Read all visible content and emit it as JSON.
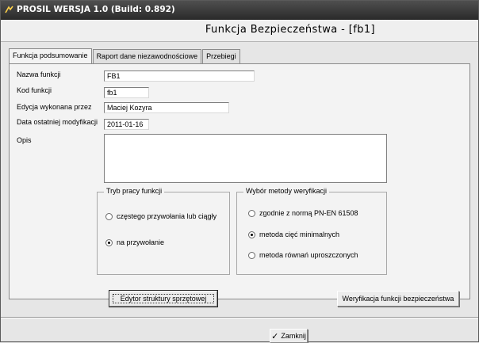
{
  "titlebar": {
    "title": "PROSIL WERSJA 1.0 (Build: 0.892)",
    "icon": "app-icon"
  },
  "header": {
    "heading": "Funkcja Bezpieczeństwa - [fb1]"
  },
  "tabs": [
    {
      "label": "Funkcja podsumowanie",
      "active": true
    },
    {
      "label": "Raport dane niezawodnościowe",
      "active": false
    },
    {
      "label": "Przebiegi",
      "active": false
    }
  ],
  "form": {
    "name_label": "Nazwa funkcji",
    "name_value": "FB1",
    "code_label": "Kod funkcji",
    "code_value": "fb1",
    "edited_by_label": "Edycja wykonana przez",
    "edited_by_value": "Maciej Kozyra",
    "last_modified_label": "Data ostatniej modyfikacji",
    "last_modified_value": "2011-01-16",
    "description_label": "Opis",
    "description_value": ""
  },
  "mode_group": {
    "legend": "Tryb pracy funkcji",
    "options": [
      {
        "label": "częstego przywołania lub ciągły",
        "checked": false
      },
      {
        "label": "na przywołanie",
        "checked": true
      }
    ]
  },
  "verification_group": {
    "legend": "Wybór metody weryfikacji",
    "options": [
      {
        "label": "zgodnie z normą PN-EN 61508",
        "checked": false
      },
      {
        "label": "metoda cięć minimalnych",
        "checked": true
      },
      {
        "label": "metoda równań uproszczonych",
        "checked": false
      }
    ]
  },
  "buttons": {
    "hardware_editor": "Edytor struktury sprzętowej",
    "verify": "Weryfikacja funkcji bezpieczeństwa",
    "close": "Zamknij"
  }
}
